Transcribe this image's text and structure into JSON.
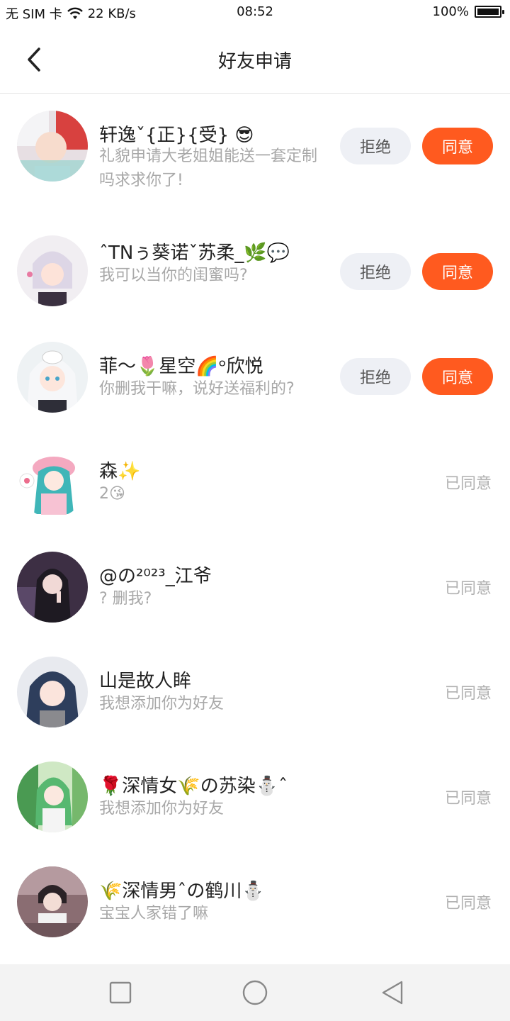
{
  "status_bar": {
    "carrier": "无 SIM 卡",
    "speed": "22 KB/s",
    "time": "08:52",
    "battery": "100%",
    "battery_level": 1.0
  },
  "header": {
    "title": "好友申请",
    "back_icon": "chevron-left-icon"
  },
  "colors": {
    "agree_button": "#ff5a1f",
    "reject_button": "#eef0f5",
    "agreed_text": "#b0b0b0",
    "message_text": "#a8a8a8"
  },
  "requests": [
    {
      "name": "轩逸ˇ{正}{受} 😎",
      "message": "礼貌申请大老姐姐能送一套定制吗求求你了!",
      "status": "pending",
      "reject_label": "拒绝",
      "agree_label": "同意"
    },
    {
      "name": "ˆTNぅ葵诺ˇ苏柔_🌿💬",
      "message": "我可以当你的闺蜜吗?",
      "status": "pending",
      "reject_label": "拒绝",
      "agree_label": "同意"
    },
    {
      "name": "菲～🌷星空🌈ᵒ欣悦",
      "message": "你删我干嘛，说好送福利的?",
      "status": "pending",
      "reject_label": "拒绝",
      "agree_label": "同意"
    },
    {
      "name": "森✨",
      "message": "2😘",
      "status": "agreed",
      "status_label": "已同意"
    },
    {
      "name": "@の²⁰²³_江爷",
      "message": "? 删我?",
      "status": "agreed",
      "status_label": "已同意"
    },
    {
      "name": "山是故人眸",
      "message": "我想添加你为好友",
      "status": "agreed",
      "status_label": "已同意"
    },
    {
      "name": "🌹深情女🌾の苏染⛄ˆ",
      "message": "我想添加你为好友",
      "status": "agreed",
      "status_label": "已同意"
    },
    {
      "name": "🌾深情男ˆの鹤川⛄",
      "message": "宝宝人家错了嘛",
      "status": "agreed",
      "status_label": "已同意"
    }
  ],
  "system_nav": {
    "recent_icon": "square-icon",
    "home_icon": "circle-icon",
    "back_icon": "triangle-back-icon"
  }
}
